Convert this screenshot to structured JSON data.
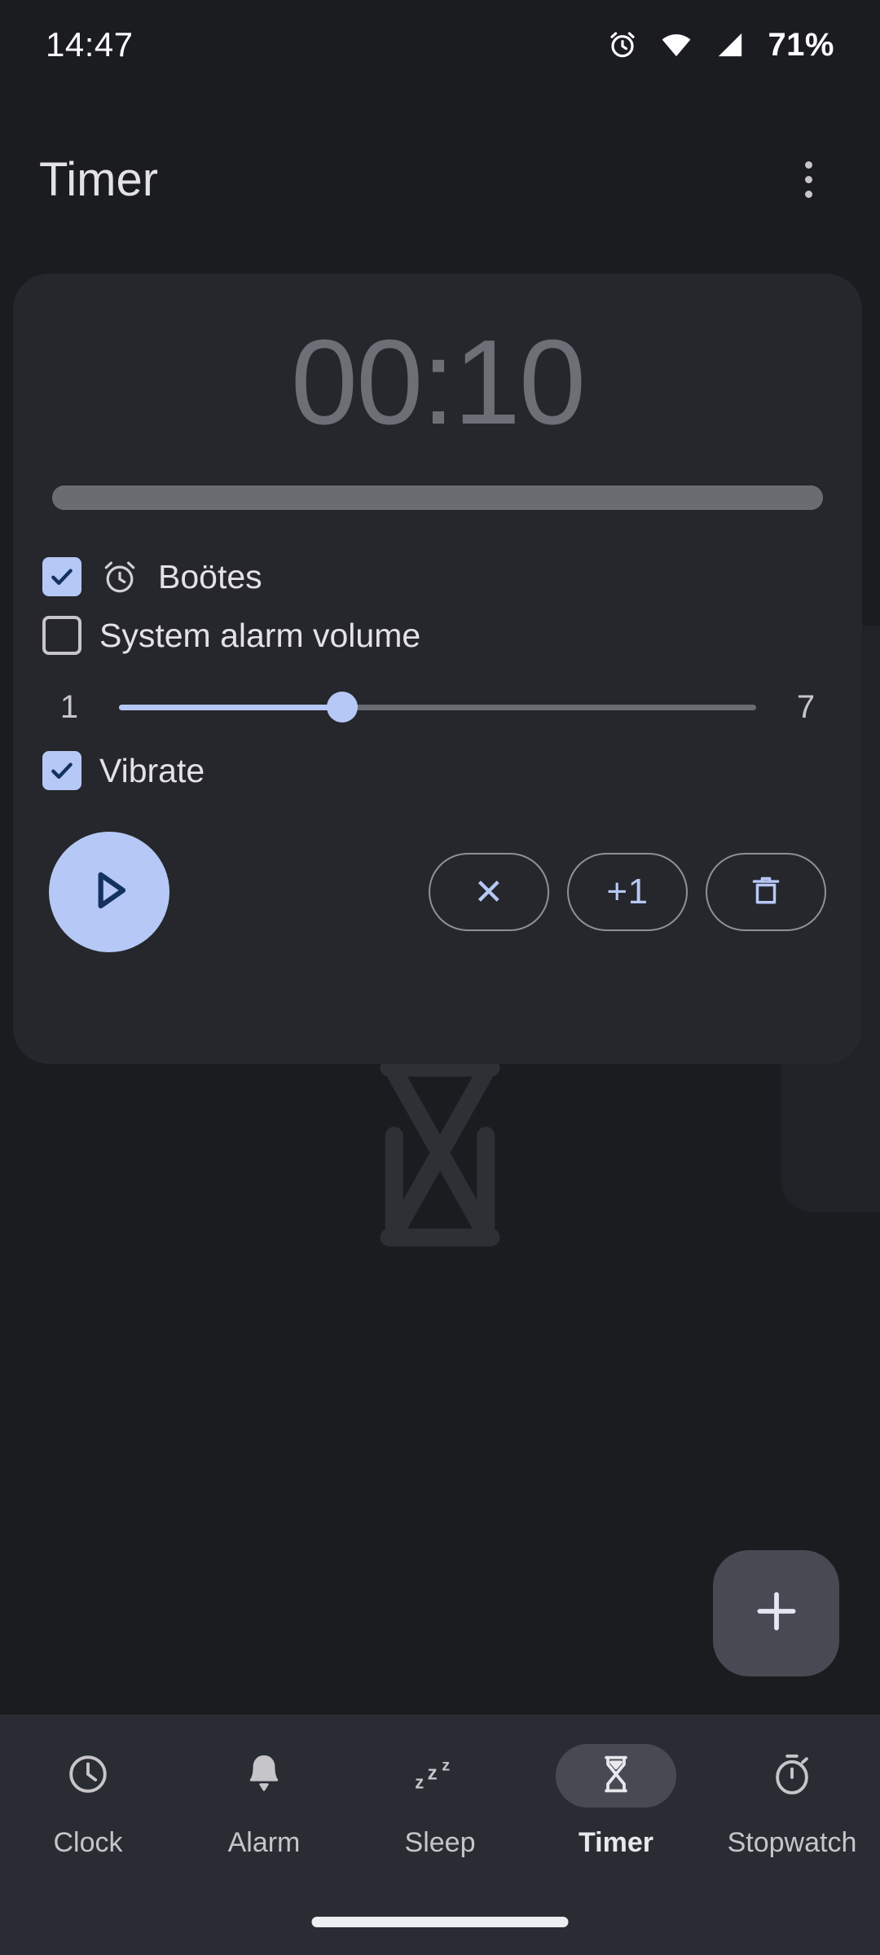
{
  "status_bar": {
    "clock": "14:47",
    "battery_percent": "71%",
    "icons": [
      "alarm-clock-icon",
      "wifi-icon",
      "cell-signal-icon"
    ]
  },
  "app_bar": {
    "title": "Timer",
    "overflow_menu": "more-options-icon"
  },
  "timer_card": {
    "display_time": "00:10",
    "progress_percent": 100,
    "ringtone_row": {
      "checked": true,
      "icon": "alarm-clock-icon",
      "label": "Boötes"
    },
    "system_volume_row": {
      "checked": false,
      "label": "System alarm volume"
    },
    "volume_slider": {
      "min_label": "1",
      "max_label": "7",
      "value": 3,
      "min": 1,
      "max": 7,
      "fill_percent": 35
    },
    "vibrate_row": {
      "checked": true,
      "label": "Vibrate"
    },
    "controls": {
      "play_label": "play-icon",
      "buttons": [
        {
          "name": "reset-button",
          "label": "✕",
          "icon": "close-icon"
        },
        {
          "name": "add-one-minute-button",
          "label": "+1",
          "icon": "plus-one-icon"
        },
        {
          "name": "delete-timer-button",
          "label": "",
          "icon": "trash-icon"
        }
      ]
    }
  },
  "fab": {
    "icon": "plus-icon",
    "label": "+"
  },
  "bottom_nav": {
    "items": [
      {
        "label": "Clock",
        "icon": "clock-icon",
        "active": false
      },
      {
        "label": "Alarm",
        "icon": "bell-icon",
        "active": false
      },
      {
        "label": "Sleep",
        "icon": "sleep-zzz-icon",
        "active": false
      },
      {
        "label": "Timer",
        "icon": "hourglass-icon",
        "active": true
      },
      {
        "label": "Stopwatch",
        "icon": "stopwatch-icon",
        "active": false
      }
    ]
  },
  "colors": {
    "background": "#1b1c20",
    "card": "#26272c",
    "accent": "#b6c8f5",
    "accent_dark": "#1c3055",
    "nav_bar": "#2a2c33",
    "text_primary": "#e3e2e6",
    "text_secondary": "#c6c5ca",
    "timer_digits": "#6d6f76"
  }
}
